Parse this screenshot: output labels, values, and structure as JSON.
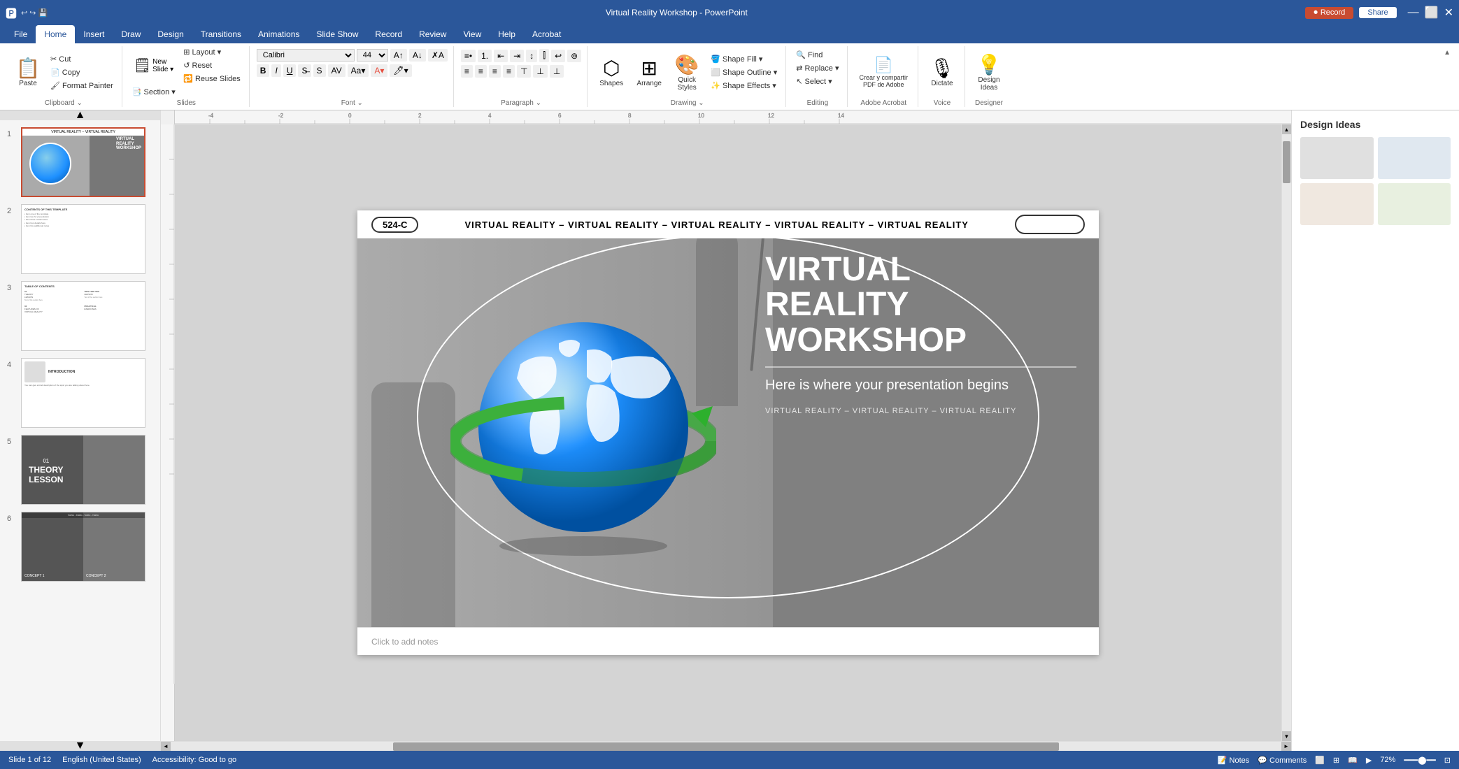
{
  "titlebar": {
    "filename": "Virtual Reality Workshop - PowerPoint",
    "record_label": "Record",
    "share_label": "Share"
  },
  "ribbon": {
    "tabs": [
      "File",
      "Home",
      "Insert",
      "Draw",
      "Design",
      "Transitions",
      "Animations",
      "Slide Show",
      "Record",
      "Review",
      "View",
      "Help",
      "Acrobat"
    ],
    "active_tab": "Home",
    "groups": {
      "clipboard": {
        "label": "Clipboard",
        "buttons": [
          "Paste",
          "Cut",
          "Copy",
          "Format Painter"
        ]
      },
      "slides": {
        "label": "Slides",
        "buttons": [
          "New Slide",
          "Layout",
          "Reset",
          "Reuse Slides",
          "Section"
        ]
      },
      "font": {
        "label": "Font",
        "font_name": "Calibri",
        "font_size": "44"
      },
      "paragraph": {
        "label": "Paragraph"
      },
      "drawing": {
        "label": "Drawing",
        "buttons": [
          "Shapes",
          "Arrange",
          "Quick Styles",
          "Shape Fill",
          "Shape Outline",
          "Shape Effects"
        ]
      },
      "editing": {
        "label": "Editing",
        "buttons": [
          "Find",
          "Replace",
          "Select"
        ]
      },
      "acrobat": {
        "label": "Adobe Acrobat",
        "buttons": [
          "Crear y compartir PDF de Adobe"
        ]
      },
      "voice": {
        "label": "Voice",
        "buttons": [
          "Dictate"
        ]
      },
      "designer": {
        "label": "Designer",
        "buttons": [
          "Design Ideas"
        ]
      }
    }
  },
  "slides": [
    {
      "num": 1,
      "active": true,
      "title": "VIRTUAL REALITY Workshop"
    },
    {
      "num": 2,
      "active": false,
      "title": "CONTENTS OF THIS TEMPLATE"
    },
    {
      "num": 3,
      "active": false,
      "title": "TABLE OF CONTENTS"
    },
    {
      "num": 4,
      "active": false,
      "title": "INTRODUCTION"
    },
    {
      "num": 5,
      "active": false,
      "title": "01 THEORY LESSON"
    },
    {
      "num": 6,
      "active": false,
      "title": "CONCEPT 1 / CONCEPT 2"
    }
  ],
  "slide": {
    "badge": "524-C",
    "header_text": "VIRTUAL REALITY  – VIRTUAL REALITY – VIRTUAL REALITY  – VIRTUAL REALITY  – VIRTUAL REALITY",
    "title_line1": "VIRTUAL",
    "title_line2": "REALITY",
    "title_line3": "WORKSHOP",
    "subtitle": "Here is where your presentation begins",
    "footer_text": "VIRTUAL REALITY  – VIRTUAL REALITY – VIRTUAL REALITY"
  },
  "notes": {
    "placeholder": "Click to add notes"
  },
  "statusbar": {
    "slide_info": "Slide 1 of 12",
    "language": "English (United States)",
    "accessibility": "Accessibility: Good to go",
    "zoom": "72%",
    "fit_btn": "Fit slide to current window"
  },
  "designer": {
    "title": "Design Ideas"
  }
}
